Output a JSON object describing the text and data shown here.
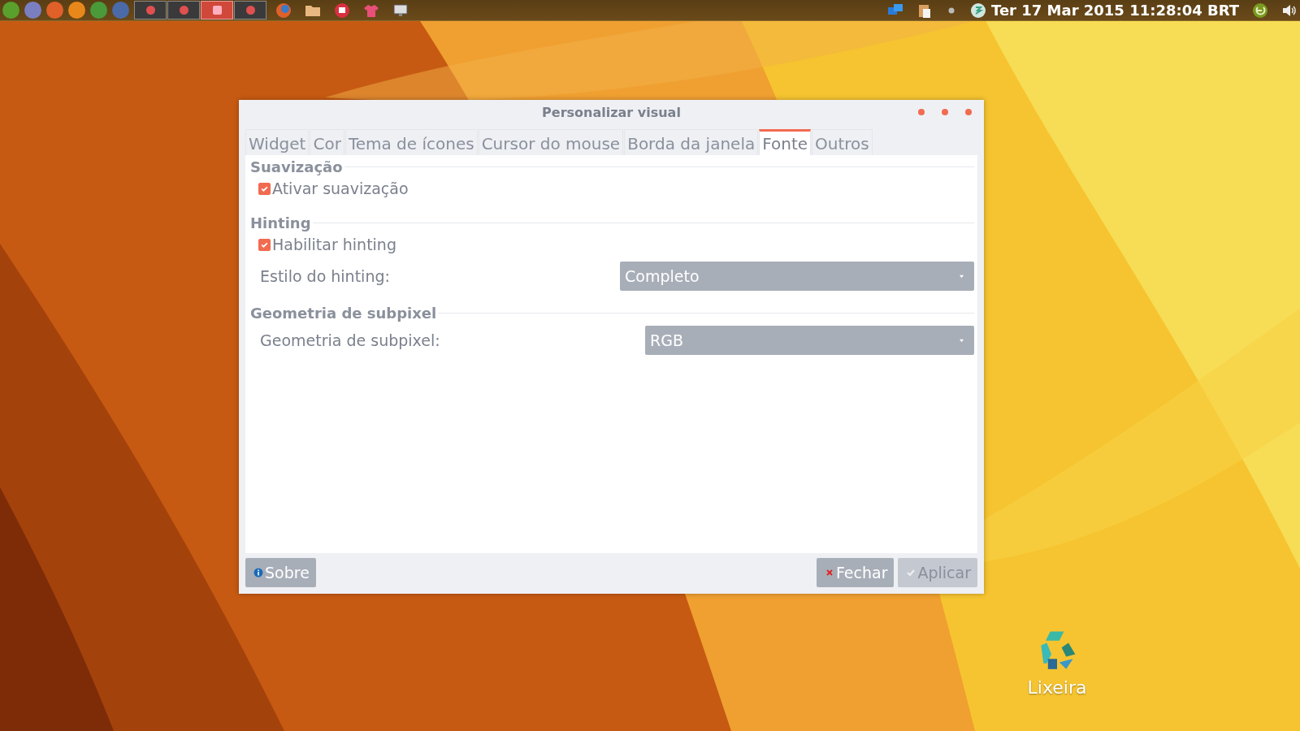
{
  "panel": {
    "tasks": [
      {
        "selected": false
      },
      {
        "selected": false
      },
      {
        "selected": true
      },
      {
        "selected": false
      }
    ],
    "clock": "Ter 17 Mar 2015 11:28:04 BRT"
  },
  "window": {
    "title": "Personalizar visual",
    "tabs": [
      {
        "label": "Widget",
        "selected": false
      },
      {
        "label": "Cor",
        "selected": false
      },
      {
        "label": "Tema de ícones",
        "selected": false
      },
      {
        "label": "Cursor do mouse",
        "selected": false
      },
      {
        "label": "Borda da janela",
        "selected": false
      },
      {
        "label": "Fonte",
        "selected": true
      },
      {
        "label": "Outros",
        "selected": false
      }
    ],
    "sections": [
      {
        "title": "Suavização",
        "rows": [
          {
            "kind": "checkbox",
            "label": "Ativar suavização",
            "checked": true
          }
        ]
      },
      {
        "title": "Hinting",
        "rows": [
          {
            "kind": "checkbox",
            "label": "Habilitar hinting",
            "checked": true
          },
          {
            "kind": "dropdown",
            "label": "Estilo do hinting:",
            "value": "Completo"
          }
        ]
      },
      {
        "title": "Geometria de subpixel",
        "rows": [
          {
            "kind": "dropdown",
            "label": "Geometria de subpixel:",
            "value": "RGB"
          }
        ]
      }
    ],
    "buttons": [
      {
        "kind": "about",
        "label": "Sobre",
        "disabled": false
      },
      {
        "kind": "close",
        "label": "Fechar",
        "disabled": false
      },
      {
        "kind": "apply",
        "label": "Aplicar",
        "disabled": true
      }
    ]
  },
  "desktop_icons": [
    {
      "label": "Lixeira"
    }
  ]
}
